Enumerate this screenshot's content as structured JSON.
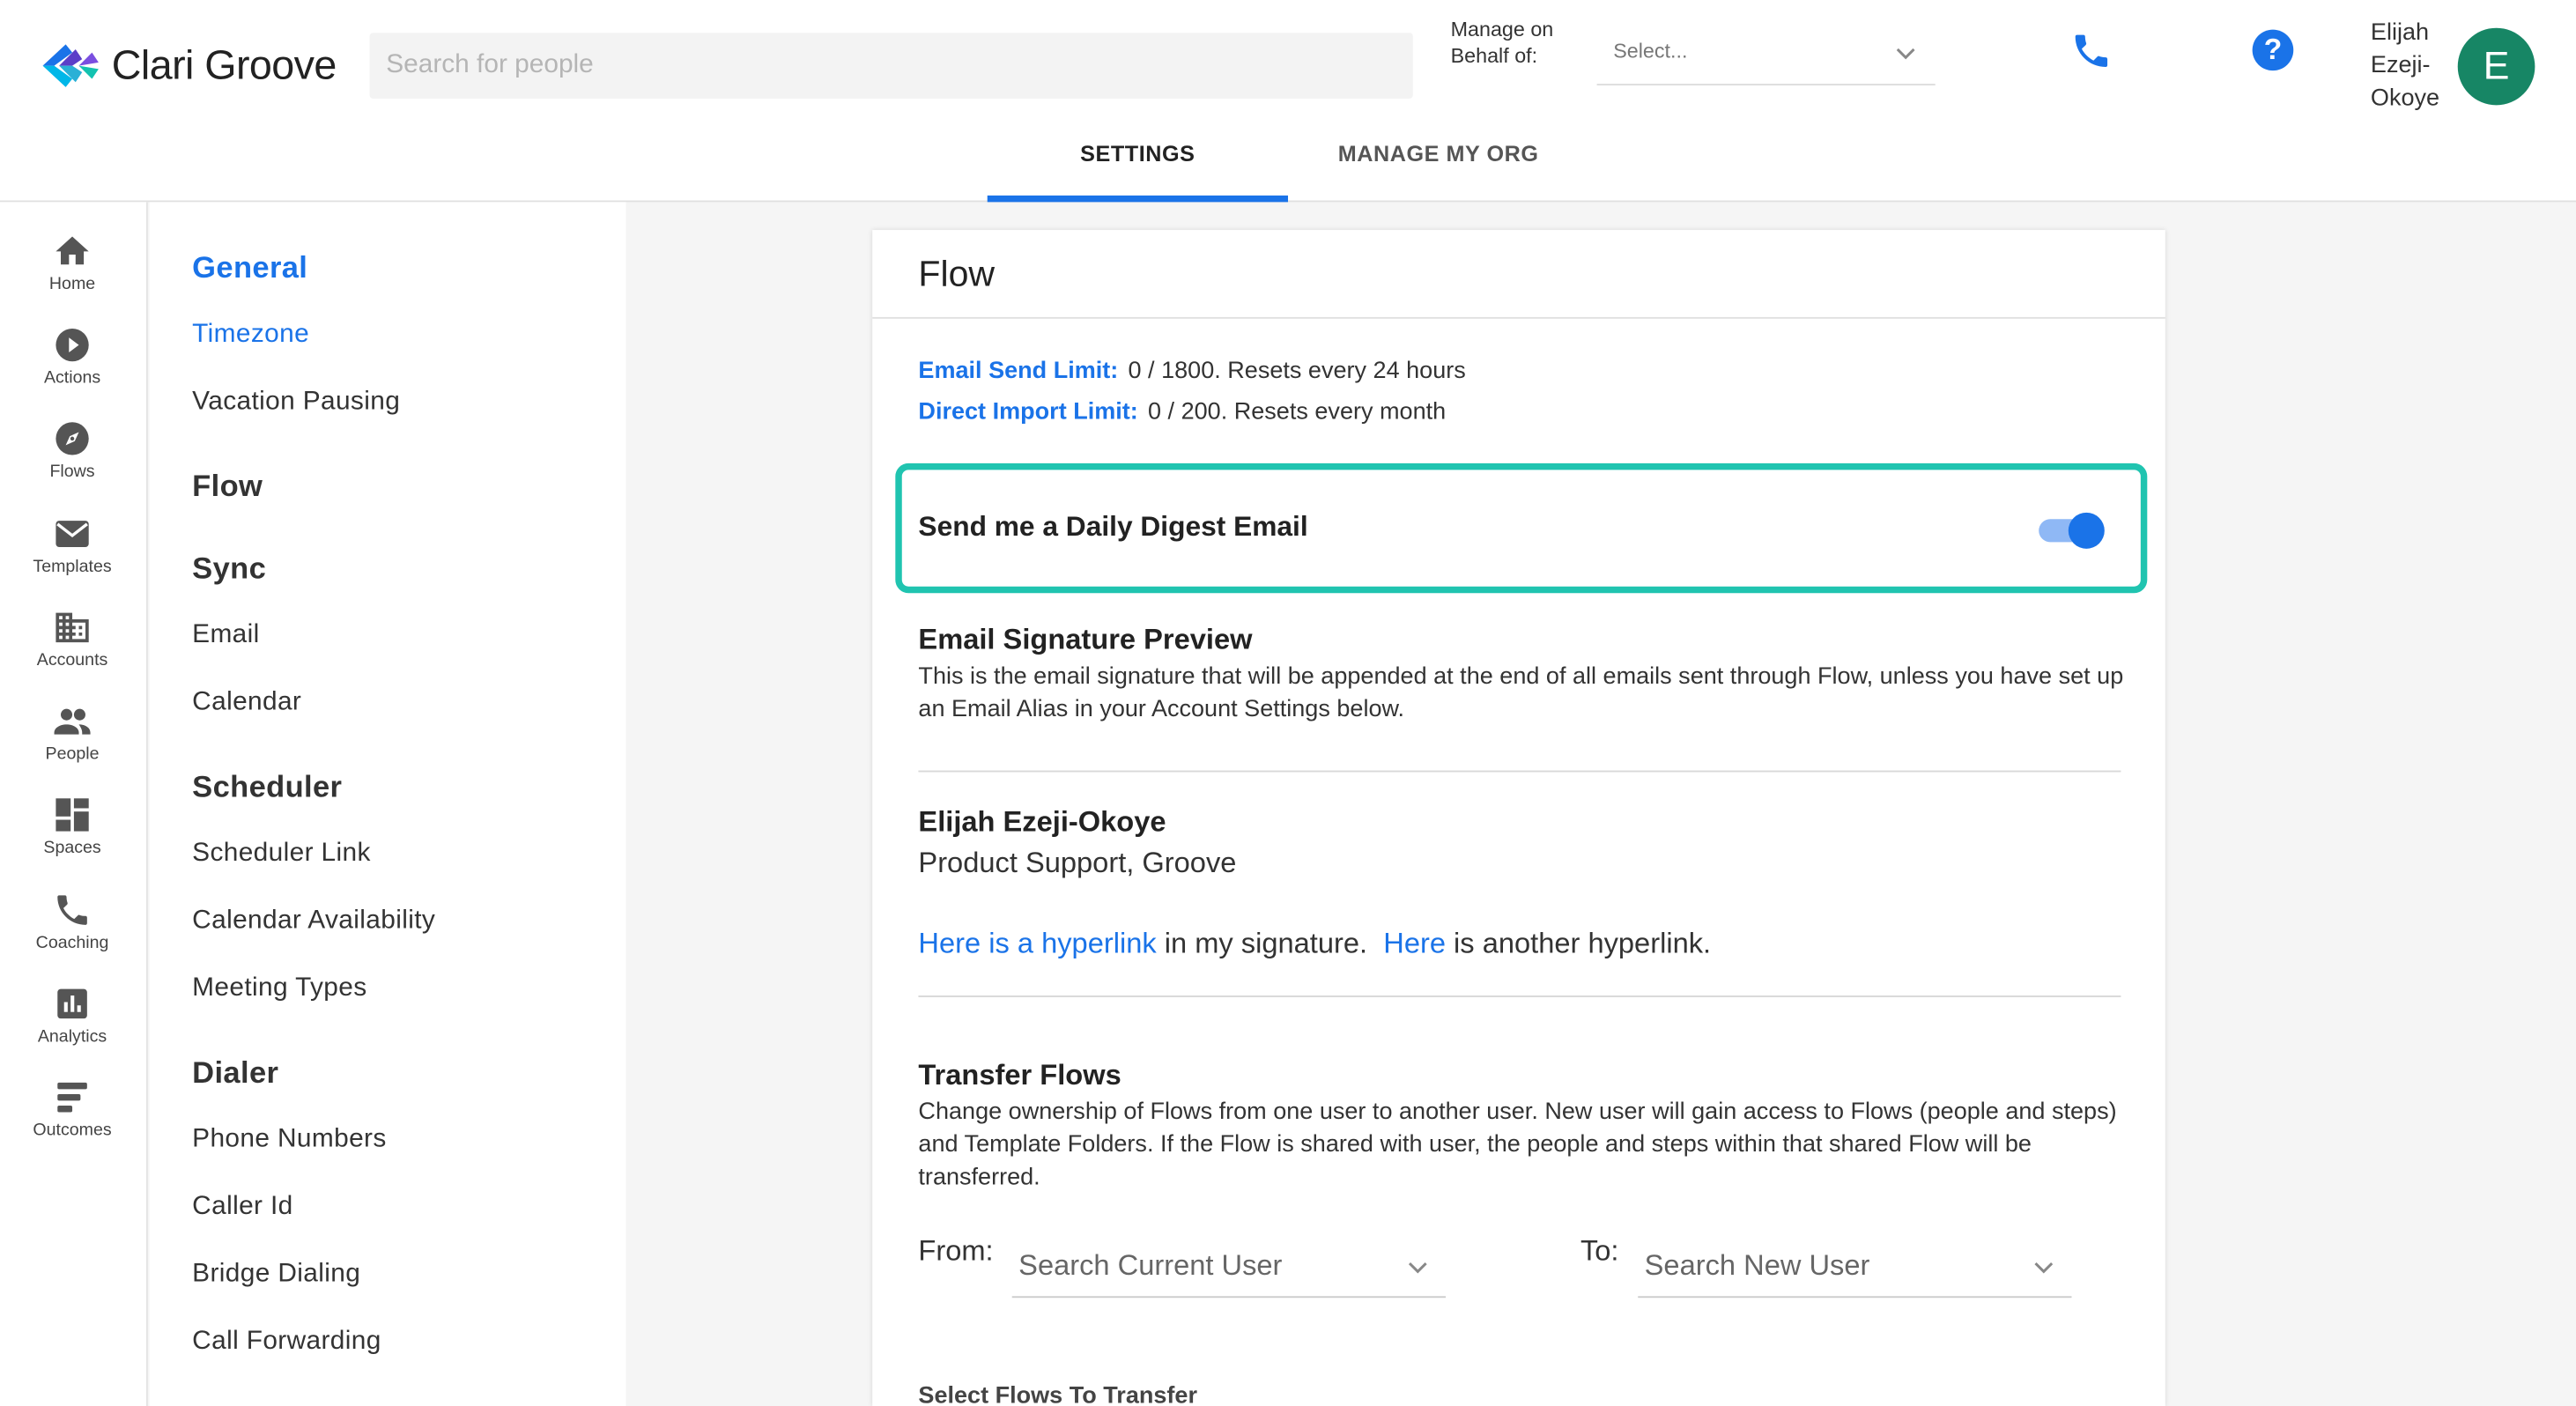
{
  "brand": {
    "name": "Clari Groove",
    "accent": "#1a73e8",
    "avatar_color": "#178665",
    "highlight": "#20c4b0"
  },
  "search": {
    "placeholder": "Search for people"
  },
  "behalf": {
    "label": "Manage on Behalf of:",
    "select_value": "Select..."
  },
  "header_icons": [
    "phone-icon",
    "help-icon"
  ],
  "user": {
    "name": "Elijah Ezeji-Okoye",
    "initial": "E"
  },
  "tabs": [
    {
      "label": "SETTINGS",
      "active": true
    },
    {
      "label": "MANAGE MY ORG",
      "active": false
    }
  ],
  "rail": [
    {
      "label": "Home",
      "icon": "home-icon"
    },
    {
      "label": "Actions",
      "icon": "play-circle-icon"
    },
    {
      "label": "Flows",
      "icon": "compass-icon"
    },
    {
      "label": "Templates",
      "icon": "envelope-icon"
    },
    {
      "label": "Accounts",
      "icon": "building-icon"
    },
    {
      "label": "People",
      "icon": "people-icon"
    },
    {
      "label": "Spaces",
      "icon": "grid-icon"
    },
    {
      "label": "Coaching",
      "icon": "phone-icon"
    },
    {
      "label": "Analytics",
      "icon": "bar-chart-icon"
    },
    {
      "label": "Outcomes",
      "icon": "lines-icon"
    }
  ],
  "settings_nav": [
    {
      "label": "General",
      "type": "heading",
      "active": true
    },
    {
      "label": "Timezone",
      "type": "item",
      "active": true
    },
    {
      "label": "Vacation Pausing",
      "type": "item"
    },
    {
      "label": "Flow",
      "type": "heading"
    },
    {
      "label": "Sync",
      "type": "heading"
    },
    {
      "label": "Email",
      "type": "item"
    },
    {
      "label": "Calendar",
      "type": "item"
    },
    {
      "label": "Scheduler",
      "type": "heading"
    },
    {
      "label": "Scheduler Link",
      "type": "item"
    },
    {
      "label": "Calendar Availability",
      "type": "item"
    },
    {
      "label": "Meeting Types",
      "type": "item"
    },
    {
      "label": "Dialer",
      "type": "heading"
    },
    {
      "label": "Phone Numbers",
      "type": "item"
    },
    {
      "label": "Caller Id",
      "type": "item"
    },
    {
      "label": "Bridge Dialing",
      "type": "item"
    },
    {
      "label": "Call Forwarding",
      "type": "item"
    }
  ],
  "main": {
    "title": "Flow",
    "email_limit": {
      "label": "Email Send Limit:",
      "value": "0 / 1800. Resets every 24 hours"
    },
    "import_limit": {
      "label": "Direct Import Limit:",
      "value": "0 / 200. Resets every month"
    },
    "digest": {
      "label": "Send me a Daily Digest Email",
      "enabled": true
    },
    "signature": {
      "heading": "Email Signature Preview",
      "description": "This is the email signature that will be appended at the end of all emails sent through Flow, unless you have set up an Email Alias in your Account Settings below.",
      "name": "Elijah Ezeji-Okoye",
      "title": "Product Support, Groove",
      "link1": "Here is a hyperlink",
      "text1": " in my signature.  ",
      "link2": "Here",
      "text2": " is another hyperlink."
    },
    "transfer": {
      "heading": "Transfer Flows",
      "description": "Change ownership of Flows from one user to another user. New user will gain access to Flows (people and steps) and Template Folders. If the Flow is shared with user, the people and steps within that shared Flow will be transferred.",
      "from_label": "From:",
      "from_placeholder": "Search Current User",
      "to_label": "To:",
      "to_placeholder": "Search New User",
      "select_label": "Select Flows To Transfer"
    }
  }
}
